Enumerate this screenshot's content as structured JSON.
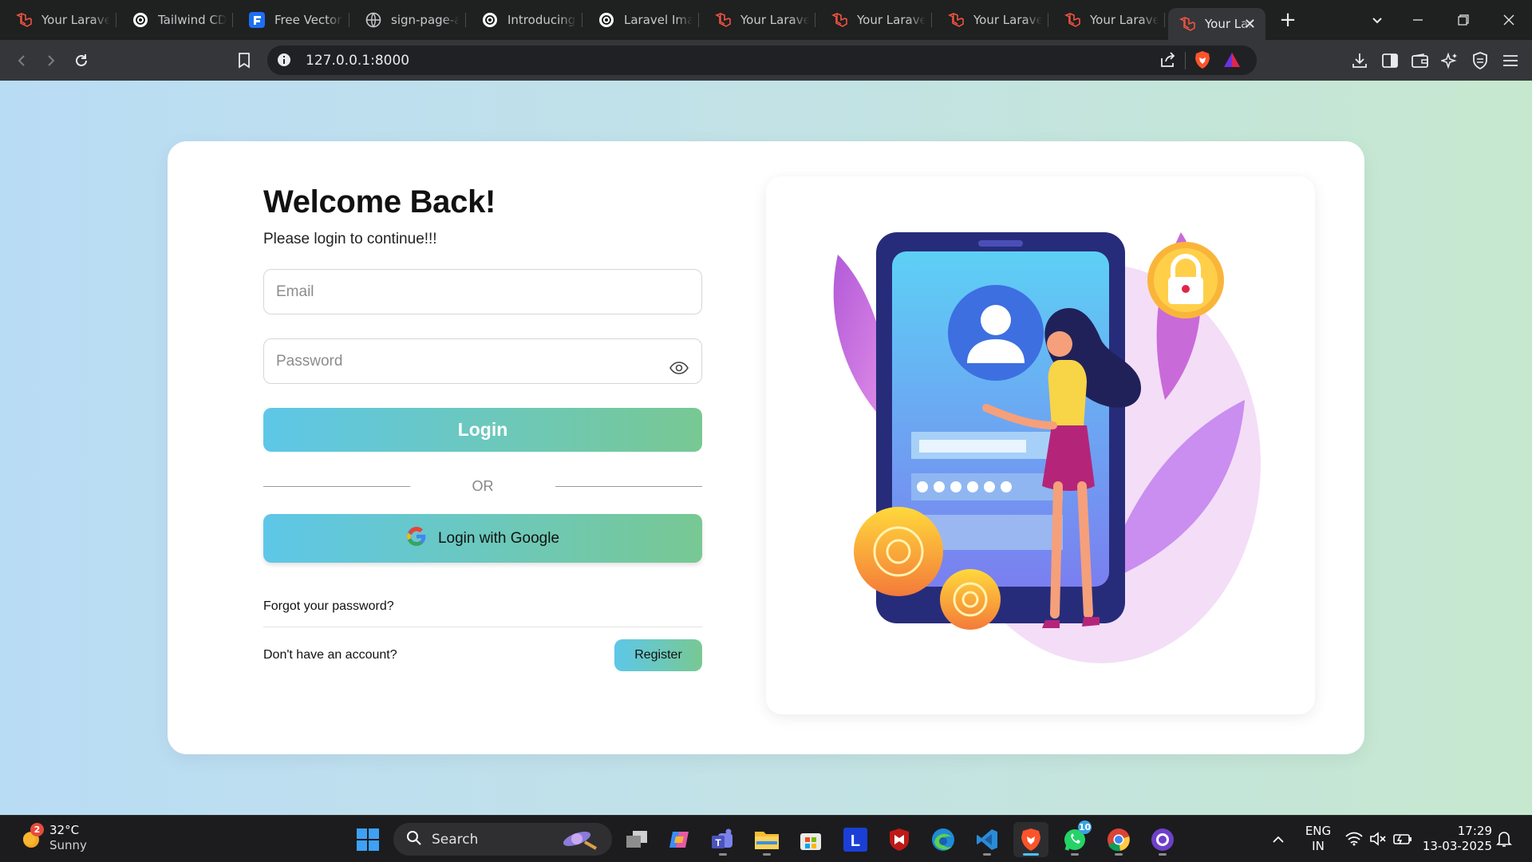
{
  "browser": {
    "tabs": [
      {
        "title": "Your Laravel",
        "icon": "laravel-icon"
      },
      {
        "title": "Tailwind CDN",
        "icon": "openai-icon"
      },
      {
        "title": "Free Vector |",
        "icon": "freepik-icon"
      },
      {
        "title": "sign-page-ab",
        "icon": "globe-icon"
      },
      {
        "title": "Introducing C",
        "icon": "openai-icon"
      },
      {
        "title": "Laravel Imag",
        "icon": "openai-icon"
      },
      {
        "title": "Your Laravel",
        "icon": "laravel-icon"
      },
      {
        "title": "Your Laravel",
        "icon": "laravel-icon"
      },
      {
        "title": "Your Laravel",
        "icon": "laravel-icon"
      },
      {
        "title": "Your Laravel",
        "icon": "laravel-icon"
      }
    ],
    "active_tab": {
      "title": "Your Lar",
      "icon": "laravel-icon"
    },
    "url": "127.0.0.1:8000"
  },
  "login": {
    "title": "Welcome Back!",
    "subtitle": "Please login to continue!!!",
    "email_placeholder": "Email",
    "password_placeholder": "Password",
    "login_label": "Login",
    "or_label": "OR",
    "google_label": "Login with Google",
    "forgot_label": "Forgot your password?",
    "no_account_label": "Don't have an account?",
    "register_label": "Register"
  },
  "colors": {
    "button_gradient_start": "#5ec7e8",
    "button_gradient_end": "#78c893"
  },
  "taskbar": {
    "weather_badge": "2",
    "temperature": "32°C",
    "condition": "Sunny",
    "search_label": "Search",
    "whatsapp_badge": "10",
    "language": "ENG",
    "region": "IN",
    "time": "17:29",
    "date": "13-03-2025"
  }
}
